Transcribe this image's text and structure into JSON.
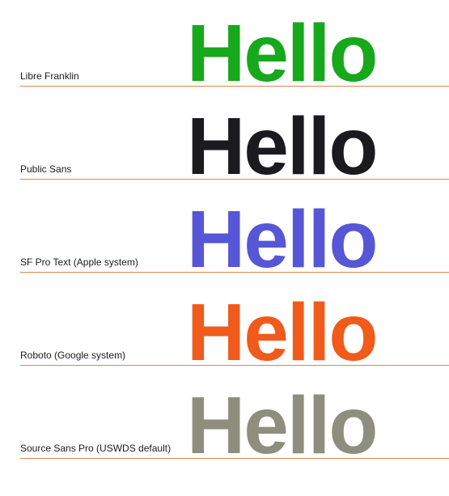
{
  "specimens": [
    {
      "label": "Libre Franklin",
      "sample": "Hello",
      "color": "#17a81b"
    },
    {
      "label": "Public Sans",
      "sample": "Hello",
      "color": "#1b1b1f"
    },
    {
      "label": "SF Pro Text (Apple system)",
      "sample": "Hello",
      "color": "#5656d6"
    },
    {
      "label": "Roboto (Google system)",
      "sample": "Hello",
      "color": "#f05a1a"
    },
    {
      "label": "Source Sans Pro (USWDS default)",
      "sample": "Hello",
      "color": "#8e8e7e"
    }
  ],
  "rule_color": "#e1844f"
}
